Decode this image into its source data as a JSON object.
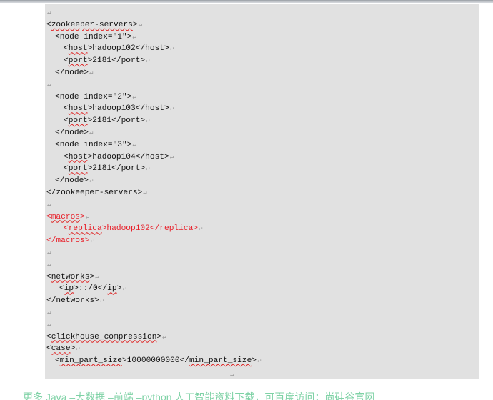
{
  "document": {
    "pilcrow": "↵",
    "lines": [
      {
        "indent": 0,
        "segments": []
      },
      {
        "indent": 0,
        "segments": [
          {
            "t": "<"
          },
          {
            "t": "zookeeper-servers",
            "u": true
          },
          {
            "t": ">"
          }
        ]
      },
      {
        "indent": 1,
        "segments": [
          {
            "t": "<node index=\"1\">"
          }
        ]
      },
      {
        "indent": 2,
        "segments": [
          {
            "t": "<"
          },
          {
            "t": "host",
            "u": true
          },
          {
            "t": ">hadoop102</host>"
          }
        ]
      },
      {
        "indent": 2,
        "segments": [
          {
            "t": "<"
          },
          {
            "t": "port",
            "u": true
          },
          {
            "t": ">2181</port>"
          }
        ]
      },
      {
        "indent": 1,
        "segments": [
          {
            "t": "</node>"
          }
        ]
      },
      {
        "indent": 0,
        "segments": []
      },
      {
        "indent": 1,
        "segments": [
          {
            "t": "<node index=\"2\">"
          }
        ]
      },
      {
        "indent": 2,
        "segments": [
          {
            "t": "<"
          },
          {
            "t": "host",
            "u": true
          },
          {
            "t": ">hadoop103</host>"
          }
        ]
      },
      {
        "indent": 2,
        "segments": [
          {
            "t": "<"
          },
          {
            "t": "port",
            "u": true
          },
          {
            "t": ">2181</port>"
          }
        ]
      },
      {
        "indent": 1,
        "segments": [
          {
            "t": "</node>"
          }
        ]
      },
      {
        "indent": 1,
        "segments": [
          {
            "t": "<node index=\"3\">"
          }
        ]
      },
      {
        "indent": 2,
        "segments": [
          {
            "t": "<"
          },
          {
            "t": "host",
            "u": true
          },
          {
            "t": ">hadoop104</host>"
          }
        ]
      },
      {
        "indent": 2,
        "segments": [
          {
            "t": "<"
          },
          {
            "t": "port",
            "u": true
          },
          {
            "t": ">2181</port>"
          }
        ]
      },
      {
        "indent": 1,
        "segments": [
          {
            "t": "</node>"
          }
        ]
      },
      {
        "indent": 0,
        "segments": [
          {
            "t": "</zookeeper-servers>"
          }
        ]
      },
      {
        "indent": 0,
        "segments": []
      },
      {
        "indent": 0,
        "red": true,
        "segments": [
          {
            "t": "<"
          },
          {
            "t": "macros",
            "u": true
          },
          {
            "t": ">"
          }
        ]
      },
      {
        "indent": 2,
        "red": true,
        "segments": [
          {
            "t": "<"
          },
          {
            "t": "replica",
            "u": true
          },
          {
            "t": ">hadoop102</replica>"
          }
        ]
      },
      {
        "indent": 0,
        "red": true,
        "segments": [
          {
            "t": "</macros>"
          }
        ]
      },
      {
        "indent": 0,
        "segments": []
      },
      {
        "indent": 0,
        "segments": []
      },
      {
        "indent": 0,
        "segments": [
          {
            "t": "<"
          },
          {
            "t": "networks",
            "u": true
          },
          {
            "t": ">"
          }
        ]
      },
      {
        "indent": 1.5,
        "segments": [
          {
            "t": "<"
          },
          {
            "t": "ip",
            "u": true
          },
          {
            "t": ">::/0</"
          },
          {
            "t": "ip",
            "u": true
          },
          {
            "t": ">"
          }
        ]
      },
      {
        "indent": 0,
        "segments": [
          {
            "t": "</networks>"
          }
        ]
      },
      {
        "indent": 0,
        "segments": []
      },
      {
        "indent": 0,
        "segments": []
      },
      {
        "indent": 0,
        "segments": [
          {
            "t": "<"
          },
          {
            "t": "clickhouse_compression",
            "u": true
          },
          {
            "t": ">"
          }
        ]
      },
      {
        "indent": 0,
        "segments": [
          {
            "t": "<"
          },
          {
            "t": "case",
            "u": true
          },
          {
            "t": ">"
          }
        ]
      },
      {
        "indent": 1,
        "segments": [
          {
            "t": "<"
          },
          {
            "t": "min_part_size",
            "u": true
          },
          {
            "t": ">10000000000</"
          },
          {
            "t": "min_part_size",
            "u": true
          },
          {
            "t": ">"
          }
        ]
      }
    ]
  },
  "footer": {
    "text": "更多 Java –大数据 –前端 –python 人工智能资料下载，可百度访问：尚硅谷官网"
  }
}
